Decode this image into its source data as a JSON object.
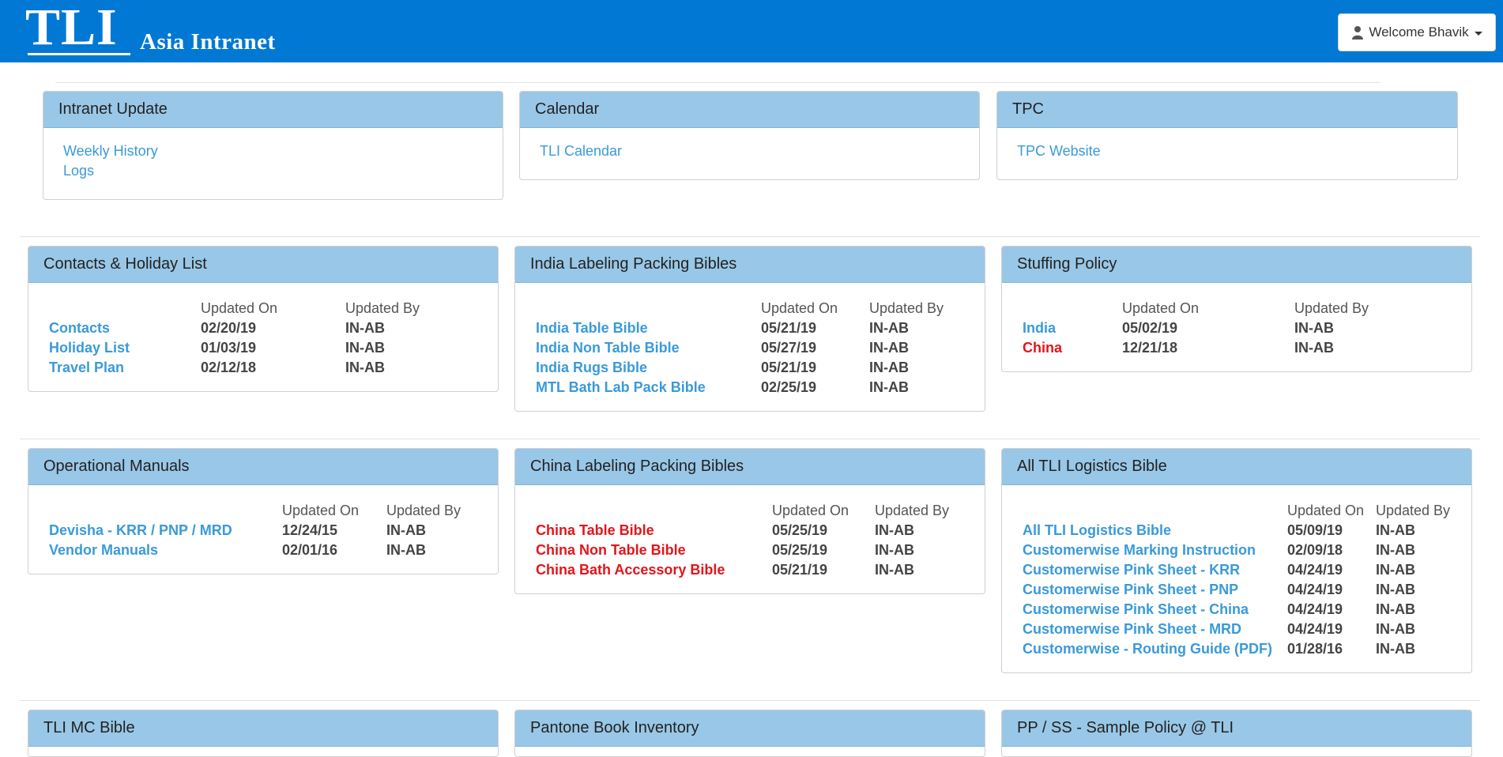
{
  "header": {
    "logo_main": "TLI",
    "logo_sub": "Asia Intranet",
    "welcome": "Welcome Bhavik",
    "bg_color": "#0178D4"
  },
  "top_panels": [
    {
      "title": "Intranet Update",
      "links": [
        "Weekly History",
        "Logs"
      ]
    },
    {
      "title": "Calendar",
      "links": [
        "TLI Calendar"
      ]
    },
    {
      "title": "TPC",
      "links": [
        "TPC Website"
      ]
    }
  ],
  "panels": [
    {
      "title": "Contacts & Holiday List",
      "col_updated_on": "Updated On",
      "col_updated_by": "Updated By",
      "rows": [
        {
          "name": "Contacts",
          "date": "02/20/19",
          "by": "IN-AB",
          "color": "blue"
        },
        {
          "name": "Holiday List",
          "date": "01/03/19",
          "by": "IN-AB",
          "color": "blue"
        },
        {
          "name": "Travel Plan",
          "date": "02/12/18",
          "by": "IN-AB",
          "color": "blue"
        }
      ]
    },
    {
      "title": "India Labeling Packing Bibles",
      "col_updated_on": "Updated On",
      "col_updated_by": "Updated By",
      "rows": [
        {
          "name": "India Table Bible",
          "date": "05/21/19",
          "by": "IN-AB",
          "color": "blue"
        },
        {
          "name": "India Non Table Bible",
          "date": "05/27/19",
          "by": "IN-AB",
          "color": "blue"
        },
        {
          "name": "India Rugs Bible",
          "date": "05/21/19",
          "by": "IN-AB",
          "color": "blue"
        },
        {
          "name": "MTL Bath Lab Pack Bible",
          "date": "02/25/19",
          "by": "IN-AB",
          "color": "blue"
        }
      ]
    },
    {
      "title": "Stuffing Policy",
      "col_updated_on": "Updated On",
      "col_updated_by": "Updated By",
      "rows": [
        {
          "name": "India",
          "date": "05/02/19",
          "by": "IN-AB",
          "color": "blue"
        },
        {
          "name": "China",
          "date": "12/21/18",
          "by": "IN-AB",
          "color": "red"
        }
      ]
    },
    {
      "title": "Operational Manuals",
      "col_updated_on": "Updated On",
      "col_updated_by": "Updated By",
      "rows": [
        {
          "name": "Devisha - KRR / PNP / MRD",
          "date": "12/24/15",
          "by": "IN-AB",
          "color": "blue"
        },
        {
          "name": "Vendor Manuals",
          "date": "02/01/16",
          "by": "IN-AB",
          "color": "blue"
        }
      ]
    },
    {
      "title": "China Labeling Packing Bibles",
      "col_updated_on": "Updated On",
      "col_updated_by": "Updated By",
      "rows": [
        {
          "name": "China Table Bible",
          "date": "05/25/19",
          "by": "IN-AB",
          "color": "red"
        },
        {
          "name": "China Non Table Bible",
          "date": "05/25/19",
          "by": "IN-AB",
          "color": "red"
        },
        {
          "name": "China Bath Accessory Bible",
          "date": "05/21/19",
          "by": "IN-AB",
          "color": "red"
        }
      ]
    },
    {
      "title": "All TLI Logistics Bible",
      "col_updated_on": "Updated On",
      "col_updated_by": "Updated By",
      "rows": [
        {
          "name": "All TLI Logistics Bible",
          "date": "05/09/19",
          "by": "IN-AB",
          "color": "blue"
        },
        {
          "name": "Customerwise Marking Instruction",
          "date": "02/09/18",
          "by": "IN-AB",
          "color": "blue"
        },
        {
          "name": "Customerwise Pink Sheet - KRR",
          "date": "04/24/19",
          "by": "IN-AB",
          "color": "blue"
        },
        {
          "name": "Customerwise Pink Sheet - PNP",
          "date": "04/24/19",
          "by": "IN-AB",
          "color": "blue"
        },
        {
          "name": "Customerwise Pink Sheet - China",
          "date": "04/24/19",
          "by": "IN-AB",
          "color": "blue"
        },
        {
          "name": "Customerwise Pink Sheet - MRD",
          "date": "04/24/19",
          "by": "IN-AB",
          "color": "blue"
        },
        {
          "name": "Customerwise - Routing Guide (PDF)",
          "date": "01/28/16",
          "by": "IN-AB",
          "color": "blue"
        }
      ]
    },
    {
      "title": "TLI MC Bible",
      "rows": []
    },
    {
      "title": "Pantone Book Inventory",
      "rows": []
    },
    {
      "title": "PP / SS - Sample Policy @ TLI",
      "rows": []
    }
  ]
}
